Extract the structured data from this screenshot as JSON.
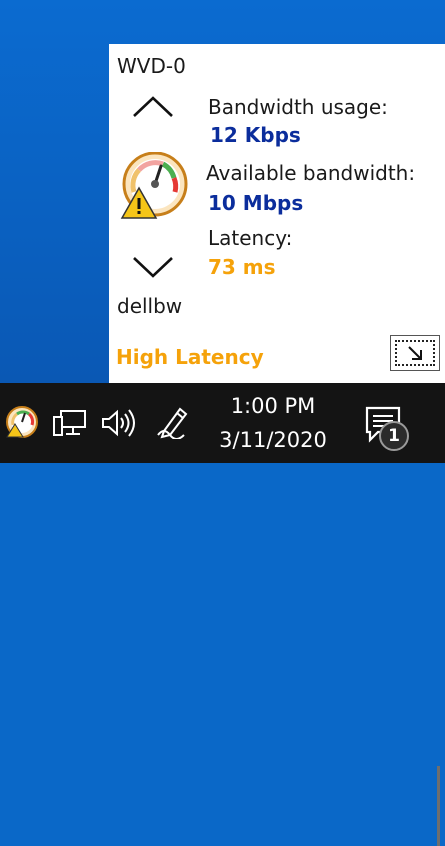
{
  "popup": {
    "host_name": "WVD-0",
    "host_id": "dellbw",
    "bandwidth_usage": {
      "label": "Bandwidth usage:",
      "value": "12 Kbps"
    },
    "available_bandwidth": {
      "label": "Available bandwidth:",
      "value": "10 Mbps"
    },
    "latency": {
      "label": "Latency:",
      "value": "73 ms"
    },
    "status": "High Latency",
    "icons": {
      "previous": "chevron-up-icon",
      "next": "chevron-down-icon",
      "gauge": "gauge-warning-icon",
      "expand": "expand-window-icon"
    },
    "colors": {
      "metric_value": "#0b2d9c",
      "warning": "#f5a20a"
    }
  },
  "taskbar": {
    "time": "1:00 PM",
    "date": "3/11/2020",
    "notification_count": "1",
    "icons": [
      "gauge-tray-icon",
      "network-icon",
      "volume-icon",
      "pen-icon",
      "action-center-icon"
    ]
  }
}
